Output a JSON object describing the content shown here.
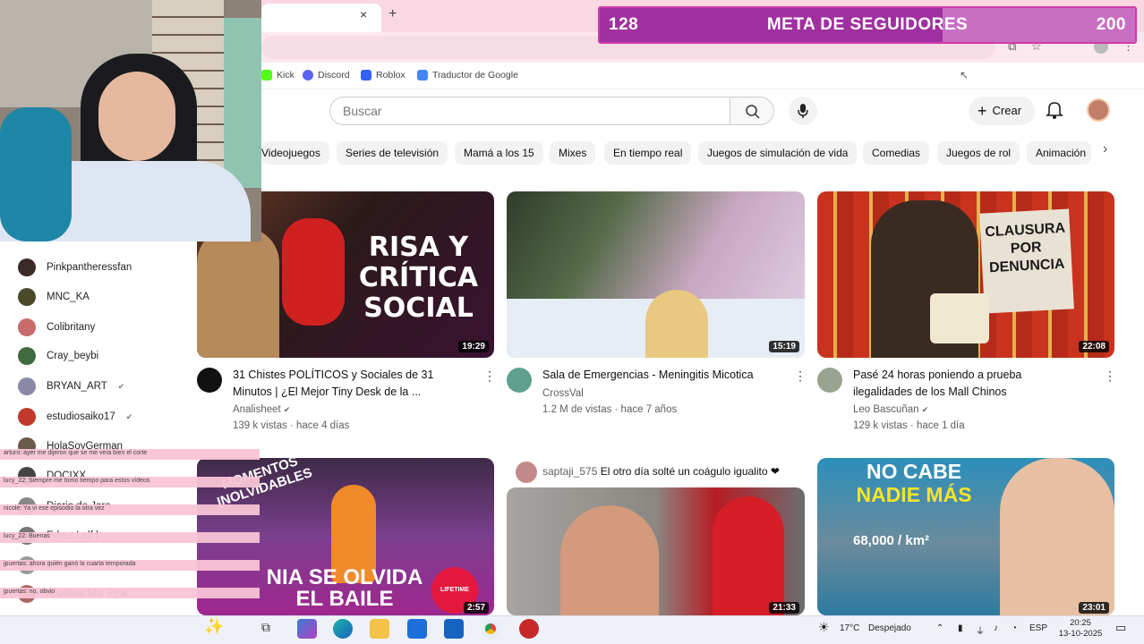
{
  "browser": {
    "tab_close": "×",
    "new_tab": "+",
    "bookmarks": [
      {
        "label": "Kick",
        "color": "#53fc18"
      },
      {
        "label": "Discord",
        "color": "#5865f2"
      },
      {
        "label": "Roblox",
        "color": "#335fff"
      },
      {
        "label": "Traductor de Google",
        "color": "#4285f4"
      }
    ]
  },
  "goal": {
    "current": "128",
    "title": "META DE SEGUIDORES",
    "target": "200",
    "progress": 0.64
  },
  "youtube": {
    "search_placeholder": "Buscar",
    "create_label": "Crear",
    "chips": [
      "Videojuegos",
      "Series de televisión",
      "Mamá a los 15",
      "Mixes",
      "En tiempo real",
      "Juegos de simulación de vida",
      "Comedias",
      "Juegos de rol",
      "Animación"
    ],
    "videos": [
      {
        "overlay": "RISA Y CRÍTICA SOCIAL",
        "duration": "19:29",
        "title1": "31 Chistes POLÍTICOS y Sociales de 31",
        "title2": "Minutos | ¿El Mejor Tiny Desk de la ...",
        "channel": "Analisheet",
        "verified": "✔",
        "meta": "139 k vistas · hace 4 días"
      },
      {
        "overlay": "",
        "duration": "15:19",
        "title1": "Sala de Emergencias - Meningitis Micotica",
        "title2": "",
        "channel": "CrossVal",
        "verified": "",
        "meta": "1.2 M de vistas · hace 7 años"
      },
      {
        "overlay": "CLAUSURA POR DENUNCIA",
        "duration": "22:08",
        "title1": "Pasé 24 horas poniendo a prueba",
        "title2": "ilegalidades de los Mall Chinos",
        "channel": "Leo Bascuñan",
        "verified": "✔",
        "meta": "129 k vistas · hace 1 día"
      },
      {
        "overlay1": "MOMENTOS INOLVIDABLES",
        "overlay2": "NIA SE OLVIDA",
        "overlay3": "EL BAILE",
        "badge": "LIFETIME",
        "duration": "2:57"
      },
      {
        "duration": "21:33"
      },
      {
        "overlay1": "NO CABE",
        "overlay2": "NADIE MÁS",
        "overlay3": "68,000 / km²",
        "duration": "23:01"
      }
    ],
    "live_comment": {
      "user": "saptaji_575",
      "text": "El otro día solté un coágulo igualito ❤"
    }
  },
  "followers": [
    "Pinkpantheressfan",
    "MNC_KA",
    "Colibritany",
    "Cray_beybi",
    "BRYAN_ART",
    "estudiosaiko17",
    "HolaSoyGerman",
    "DOCIXX",
    "Diario de Jero",
    "Edrez Lalf |",
    "ZEUS",
    "ANAlisis Ms. Pink"
  ],
  "followers_verified": "✔",
  "chat": [
    "arturo:  ayer me dijeron que se me veía bien el corte",
    "lucy_22:  Siempre me tomo tiempo para estos vídeos",
    "nicole:  Ya vi ese episodio la otra vez",
    "lucy_22:  Buenas",
    "jpuertas:  ahora quién ganó la cuarta temporada",
    "jpuertas:  no, obvio",
    "jpuertas:  ame el video jaja"
  ],
  "taskbar": {
    "weather_temp": "17°C",
    "weather_text": "Despejado",
    "lang": "ESP",
    "time": "20:25",
    "date": "13-10-2025"
  }
}
